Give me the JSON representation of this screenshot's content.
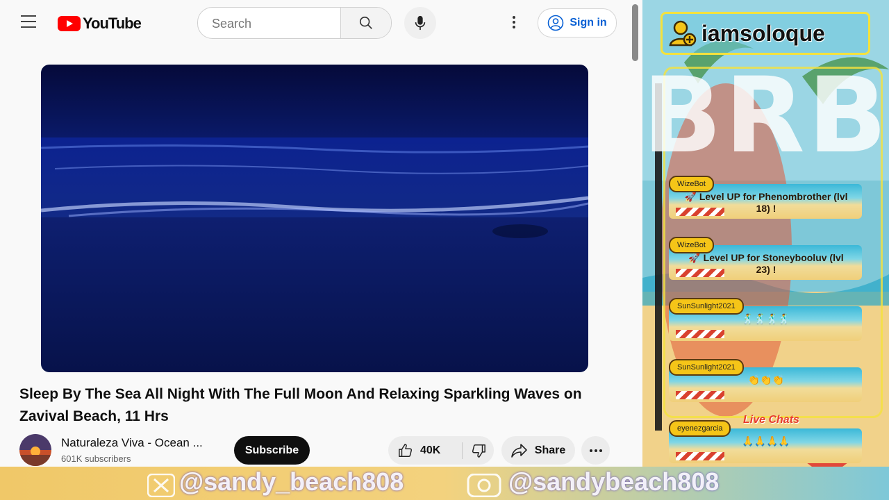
{
  "youtube": {
    "logo_text": "YouTube",
    "search": {
      "placeholder": "Search"
    },
    "signin_label": "Sign in",
    "video": {
      "title": "Sleep By The Sea All Night With The Full Moon And Relaxing Sparkling Waves on Zavival Beach, 11 Hrs",
      "channel_name": "Naturaleza Viva - Ocean ...",
      "subscribers": "601K subscribers",
      "subscribe_label": "Subscribe",
      "likes": "40K",
      "share_label": "Share"
    },
    "colors": {
      "brand_red": "#ff0000",
      "link_blue": "#065fd4"
    }
  },
  "stream": {
    "username": "iamsoloque",
    "brb_text": "BRB",
    "chat": [
      {
        "user": "WizeBot",
        "message": "🚀 Level UP for Phenombrother (lvl 18) !"
      },
      {
        "user": "WizeBot",
        "message": "🚀 Level UP for Stoneybooluv (lvl 23) !"
      },
      {
        "user": "SunSunlight2021",
        "message": "🕺🕺🕺🕺"
      },
      {
        "user": "SunSunlight2021",
        "message": "👏👏👏"
      },
      {
        "user": "eyenezgarcia",
        "message": "🙏🙏🙏🙏"
      }
    ],
    "live_chats_label": "Live Chats",
    "social_handles": [
      "@sandy_beach808",
      "@sandybeach808"
    ]
  }
}
